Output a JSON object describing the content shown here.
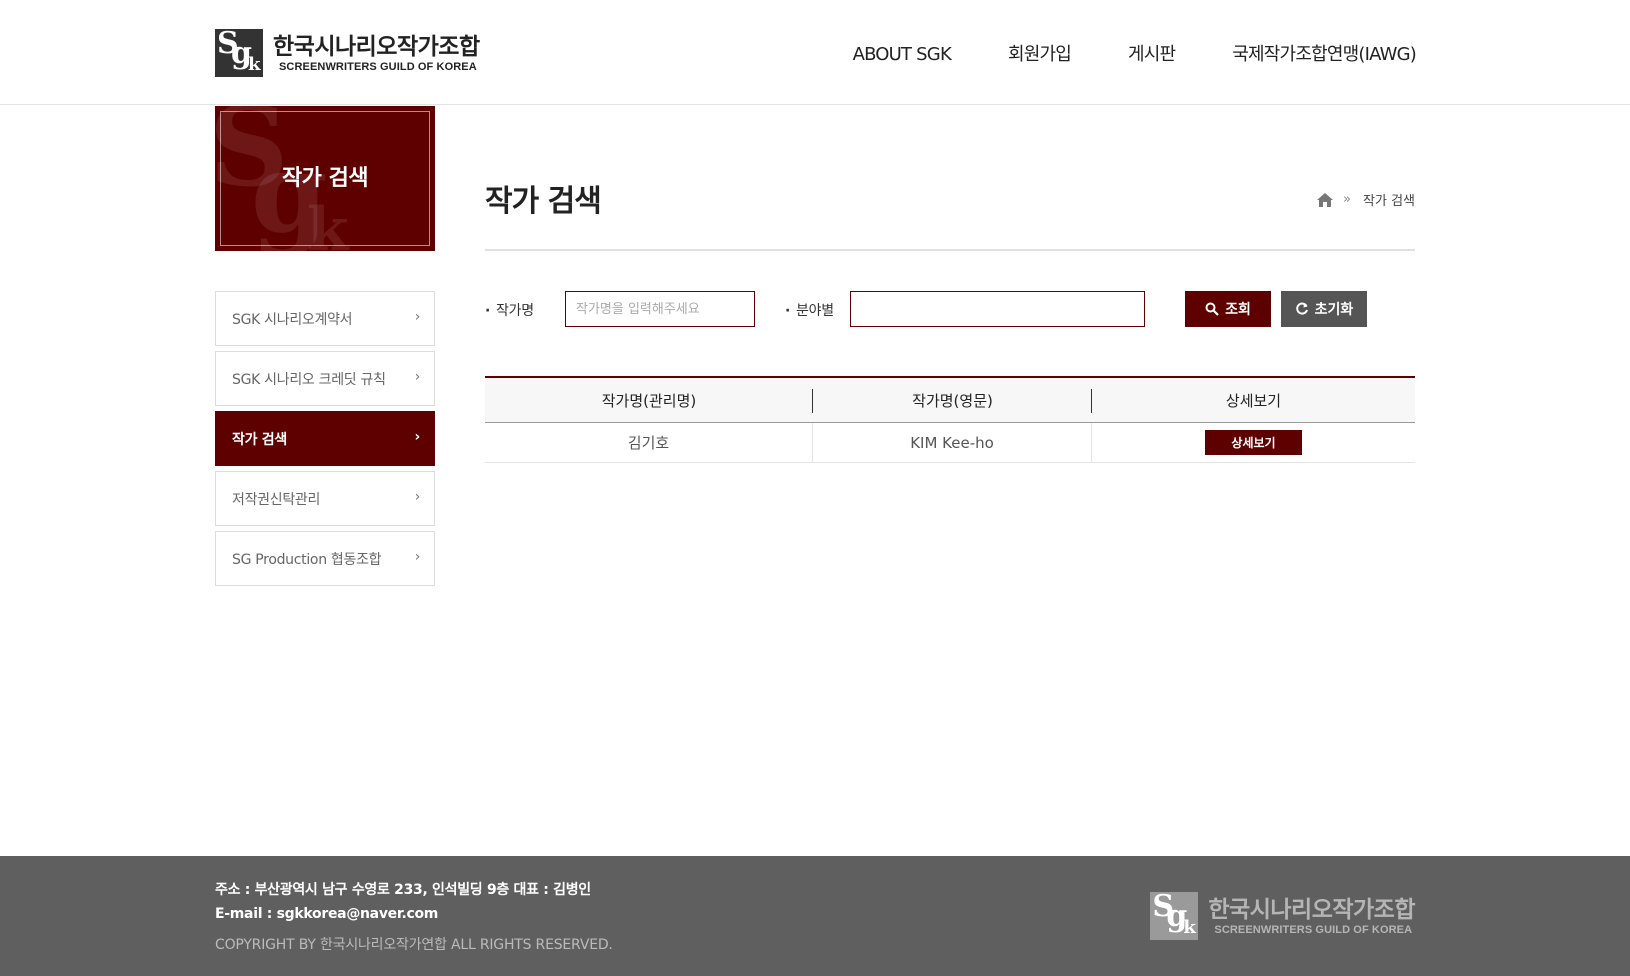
{
  "brand": {
    "mark": "Sgk",
    "name_ko": "한국시나리오작가조합",
    "name_en": "SCREENWRITERS GUILD OF KOREA"
  },
  "nav": {
    "items": [
      {
        "label": "ABOUT SGK"
      },
      {
        "label": "회원가입"
      },
      {
        "label": "게시판"
      },
      {
        "label": "국제작가조합연맹(IAWG)"
      }
    ]
  },
  "sidebar": {
    "visual_title": "작가 검색",
    "items": [
      {
        "label": "SGK 시나리오계약서",
        "arrow": "›"
      },
      {
        "label": "SGK 시나리오 크레딧 규칙",
        "arrow": "›"
      },
      {
        "label": "작가 검색",
        "arrow": "›",
        "active": true
      },
      {
        "label": "저작권신탁관리",
        "arrow": "›"
      },
      {
        "label": "SG Production 협동조합",
        "arrow": "›"
      }
    ]
  },
  "page": {
    "title": "작가 검색",
    "breadcrumb": {
      "home_icon": "home-icon",
      "separator": "»",
      "current": "작가 검색"
    }
  },
  "search": {
    "name_label": "작가명",
    "name_placeholder": "작가명을 입력해주세요",
    "name_value": "",
    "field_label": "분야별",
    "field_value": "",
    "search_button": "조회",
    "reset_button": "초기화"
  },
  "table": {
    "headers": [
      "작가명(관리명)",
      "작가명(영문)",
      "상세보기"
    ],
    "rows": [
      {
        "name_ko": "김기호",
        "name_en": "KIM Kee-ho",
        "action": "상세보기"
      }
    ]
  },
  "footer": {
    "address": "주소 : 부산광역시 남구 수영로 233, 인석빌딩 9층   대표 : 김병인",
    "email": "E-mail : sgkkorea@naver.com",
    "copyright": "COPYRIGHT BY 한국시나리오작가연합 ALL RIGHTS RESERVED."
  },
  "colors": {
    "accent": "#5f0000",
    "reset_button": "#555555",
    "footer_bg": "#5f5f5f"
  }
}
